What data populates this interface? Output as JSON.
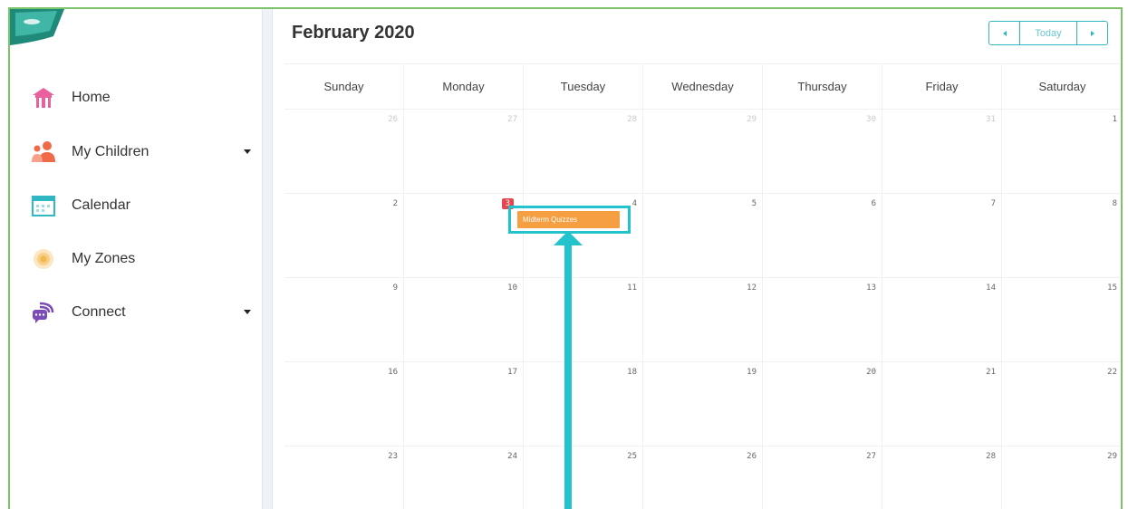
{
  "sidebar": {
    "items": [
      {
        "label": "Home",
        "icon": "home-icon",
        "color": "#e8609c"
      },
      {
        "label": "My Children",
        "icon": "children-icon",
        "color": "#f06a4a",
        "has_dropdown": true
      },
      {
        "label": "Calendar",
        "icon": "calendar-icon",
        "color": "#2fb8c4"
      },
      {
        "label": "My Zones",
        "icon": "zones-icon",
        "color": "#f2b84b"
      },
      {
        "label": "Connect",
        "icon": "connect-icon",
        "color": "#7b4bb7",
        "has_dropdown": true
      }
    ]
  },
  "calendar": {
    "title": "February 2020",
    "today_label": "Today",
    "weekdays": [
      "Sunday",
      "Monday",
      "Tuesday",
      "Wednesday",
      "Thursday",
      "Friday",
      "Saturday"
    ],
    "weeks": [
      [
        "26",
        "27",
        "28",
        "29",
        "30",
        "31",
        "1"
      ],
      [
        "2",
        "3",
        "4",
        "5",
        "6",
        "7",
        "8"
      ],
      [
        "9",
        "10",
        "11",
        "12",
        "13",
        "14",
        "15"
      ],
      [
        "16",
        "17",
        "18",
        "19",
        "20",
        "21",
        "22"
      ],
      [
        "23",
        "24",
        "25",
        "26",
        "27",
        "28",
        "29"
      ]
    ],
    "muted_days_week0": 6,
    "today_date": "3",
    "event": {
      "title": "Midterm Quizzes",
      "date": "4",
      "color": "#f59e42"
    }
  },
  "colors": {
    "accent": "#2fb8c4",
    "today_badge": "#e8444d",
    "frame_border": "#7cc46a",
    "annotation": "#22c3cc"
  }
}
